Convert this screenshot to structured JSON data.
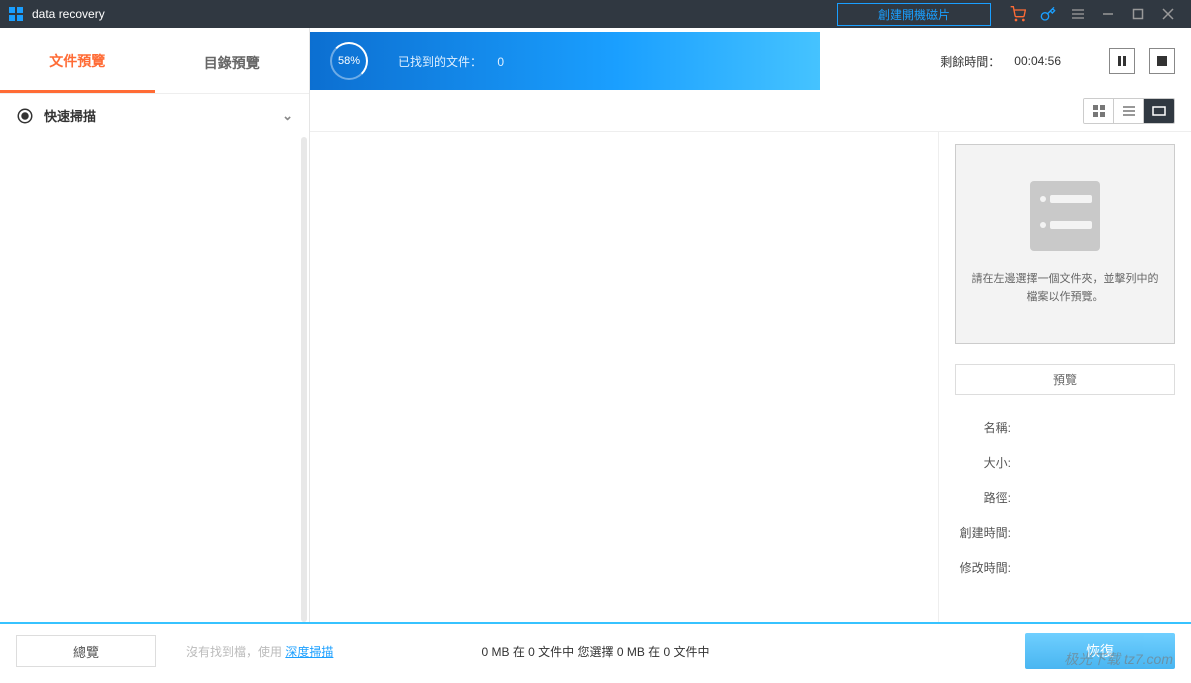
{
  "titlebar": {
    "title": "data recovery",
    "boot_button": "創建開機磁片"
  },
  "sidebar": {
    "tabs": {
      "file": "文件預覽",
      "dir": "目錄預覽"
    },
    "quick_scan": "快速掃描"
  },
  "progress": {
    "percent": "58%",
    "found_label": "已找到的文件：",
    "found_count": "0",
    "remaining_label": "剩餘時間：",
    "remaining_value": "00:04:56"
  },
  "preview": {
    "hint": "請在左邊選擇一個文件夾，並擊列中的檔案以作預覽。",
    "button": "預覽",
    "meta": {
      "name": "名稱:",
      "size": "大小:",
      "path": "路徑:",
      "created": "創建時間:",
      "modified": "修改時間:"
    }
  },
  "footer": {
    "overview": "總覽",
    "hint_prefix": "沒有找到檔，使用 ",
    "hint_link": "深度掃描",
    "stats": "0 MB 在 0 文件中  您選擇 0 MB 在 0 文件中",
    "recover": "恢復",
    "watermark": "极光下载 tz7.com"
  }
}
